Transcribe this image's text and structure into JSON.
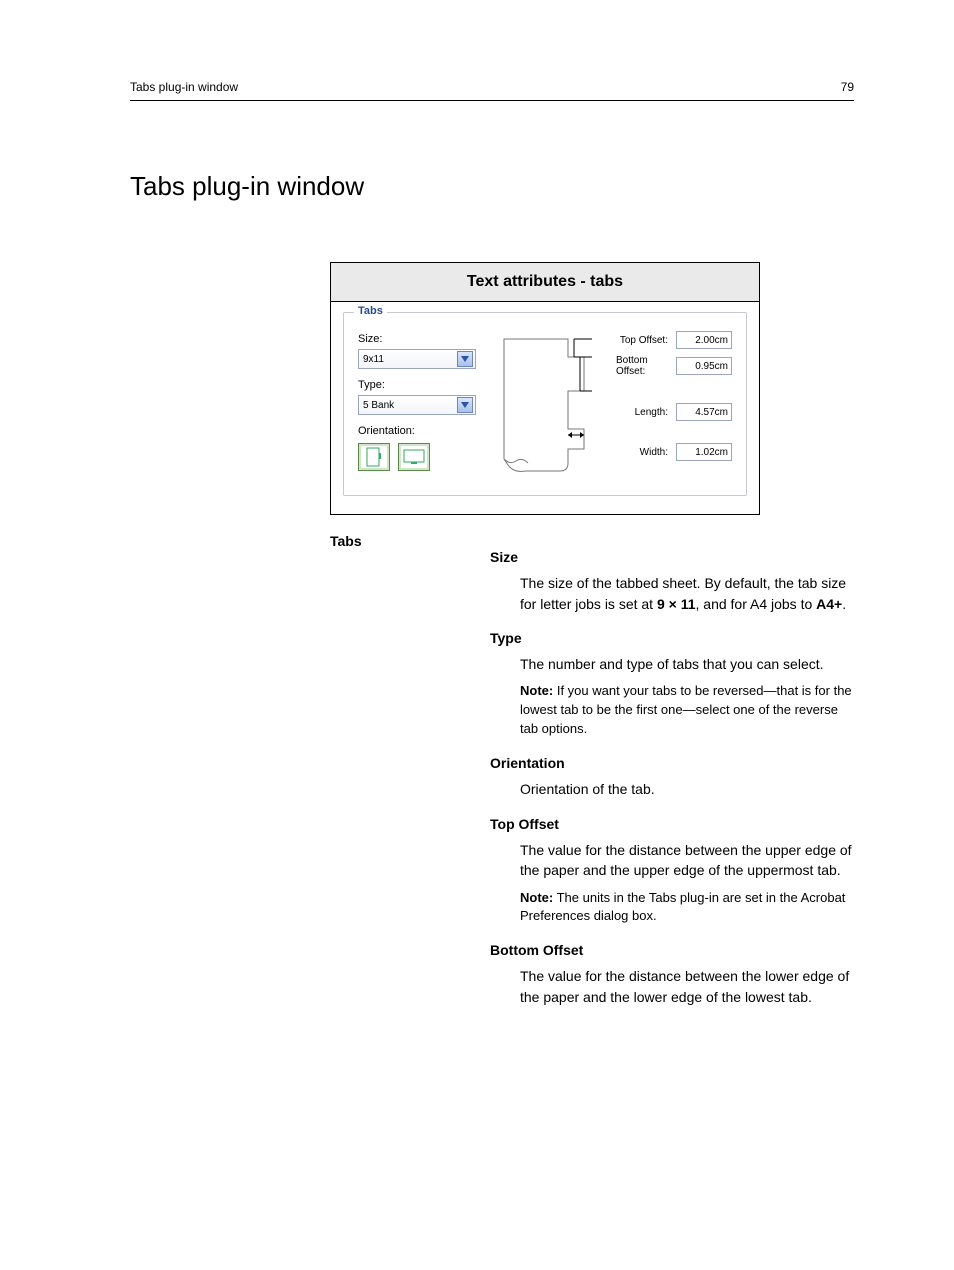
{
  "header": {
    "left": "Tabs plug-in window",
    "right": "79"
  },
  "title": "Tabs plug-in window",
  "dialog": {
    "caption": "Text attributes - tabs",
    "group_legend": "Tabs",
    "size_label": "Size:",
    "size_value": "9x11",
    "type_label": "Type:",
    "type_value": "5 Bank",
    "orientation_label": "Orientation:",
    "top_offset_label": "Top Offset:",
    "top_offset_value": "2.00cm",
    "bottom_offset_label": "Bottom Offset:",
    "bottom_offset_value": "0.95cm",
    "length_label": "Length:",
    "length_value": "4.57cm",
    "width_label": "Width:",
    "width_value": "1.02cm"
  },
  "defs": {
    "lead": "Tabs",
    "size": {
      "term": "Size",
      "text_a": "The size of the tabbed sheet. By default, the tab size for letter jobs is set at ",
      "text_b": "9 × 11",
      "text_c": ", and for A4 jobs to ",
      "text_d": "A4+",
      "text_e": "."
    },
    "type": {
      "term": "Type",
      "text": "The number and type of tabs that you can select.",
      "note_label": "Note:",
      "note": " If you want your tabs to be reversed—that is for the lowest tab to be the first one—select one of the reverse tab options."
    },
    "orientation": {
      "term": "Orientation",
      "text": "Orientation of the tab."
    },
    "top_offset": {
      "term": "Top Offset",
      "text": "The value for the distance between the upper edge of the paper and the upper edge of the uppermost tab.",
      "note_label": "Note:",
      "note": " The units in the Tabs plug-in are set in the Acrobat Preferences dialog box."
    },
    "bottom_offset": {
      "term": "Bottom Offset",
      "text": "The value for the distance between the lower edge of the paper and the lower edge of the lowest tab."
    }
  }
}
